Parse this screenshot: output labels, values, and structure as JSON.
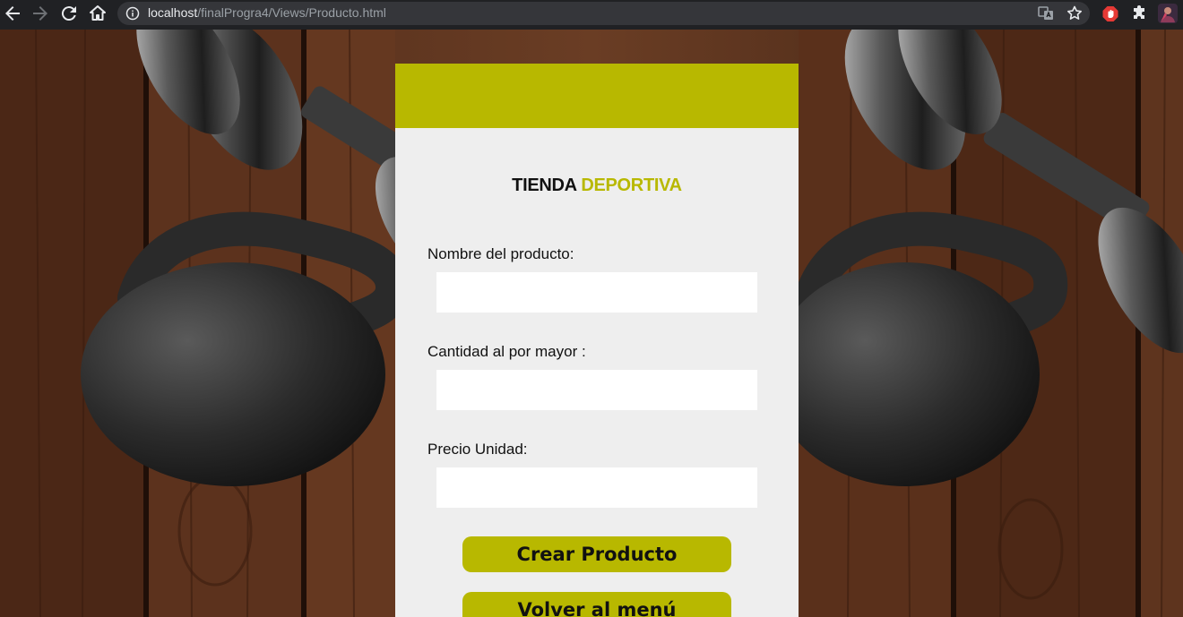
{
  "browser": {
    "url_host": "localhost",
    "url_path": "/finalProgra4/Views/Producto.html",
    "icons": [
      "back-arrow-icon",
      "forward-arrow-icon",
      "reload-icon",
      "home-icon",
      "info-icon",
      "translate-icon",
      "bookmark-star-icon",
      "adblock-icon",
      "extensions-puzzle-icon",
      "profile-avatar"
    ]
  },
  "brand": {
    "word1": "TIENDA",
    "word2": "DEPORTIVA"
  },
  "form": {
    "fields": [
      {
        "label": "Nombre del producto:",
        "value": ""
      },
      {
        "label": "Cantidad al por mayor :",
        "value": ""
      },
      {
        "label": "Precio Unidad:",
        "value": ""
      }
    ],
    "create_button": "Crear Producto",
    "back_button": "Volver al menú"
  },
  "colors": {
    "accent": "#b8b800",
    "card_background": "#eeeeee",
    "chrome_background": "#202124"
  }
}
